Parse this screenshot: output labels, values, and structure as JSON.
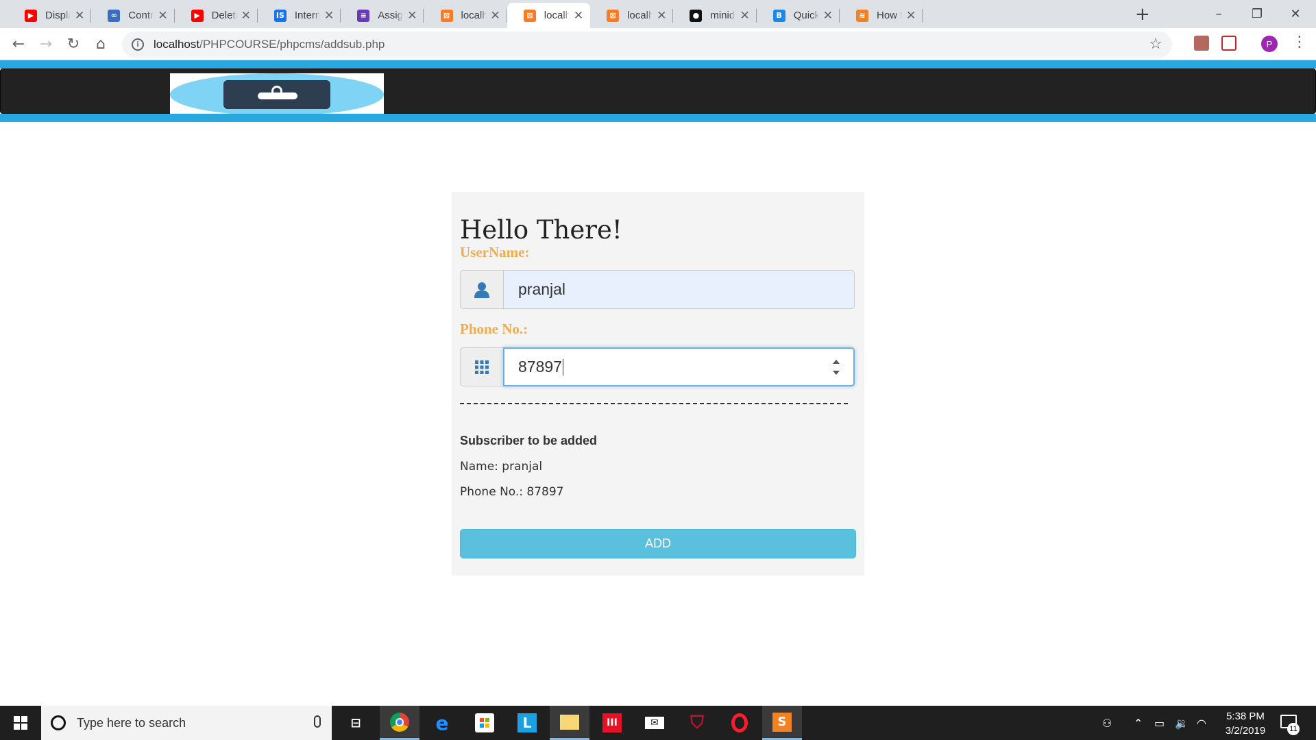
{
  "browser": {
    "tabs": [
      {
        "title": "Displaying",
        "favicon": "youtube-icon",
        "color": "#ff0000",
        "glyph": "▶"
      },
      {
        "title": "Control St",
        "favicon": "infinity-icon",
        "color": "#3b6ec2",
        "glyph": "∞"
      },
      {
        "title": "Deleting a",
        "favicon": "youtube-icon",
        "color": "#ff0000",
        "glyph": "▶"
      },
      {
        "title": "Internship",
        "favicon": "internshala-icon",
        "color": "#1a73e8",
        "glyph": "IS"
      },
      {
        "title": "Assignmen",
        "favicon": "forms-icon",
        "color": "#673ab7",
        "glyph": "≡"
      },
      {
        "title": "localhost/",
        "favicon": "xampp-icon",
        "color": "#fb7a24",
        "glyph": "⊠"
      },
      {
        "title": "localhost/",
        "favicon": "xampp-icon",
        "color": "#fb7a24",
        "glyph": "⊠",
        "active": true
      },
      {
        "title": "localhost/",
        "favicon": "xampp-icon",
        "color": "#fb7a24",
        "glyph": "⊠"
      },
      {
        "title": "minidirect",
        "favicon": "github-icon",
        "color": "#111111",
        "glyph": "●"
      },
      {
        "title": "Quick Star",
        "favicon": "bootstrap-icon",
        "color": "#1e88e5",
        "glyph": "B"
      },
      {
        "title": "How to up",
        "favicon": "stackoverflow-icon",
        "color": "#f48024",
        "glyph": "≋"
      }
    ],
    "url_host": "localhost",
    "url_path": "/PHPCOURSE/phpcms/addsub.php",
    "profile_initial": "P"
  },
  "form": {
    "heading": "Hello There!",
    "username_label": "UserName:",
    "username_value": "pranjal",
    "phone_label": "Phone No.:",
    "phone_value": "87897",
    "divider": "---------------------------------------------------------------------------------------------------------",
    "summary_title": "Subscriber to be added",
    "summary_name": "Name: pranjal",
    "summary_phone": "Phone No.: 87897",
    "add_button": "ADD"
  },
  "colors": {
    "accent_blue": "#29a7df",
    "navbar": "#222222",
    "label_orange": "#f0ad4e",
    "button_info": "#5bc0de"
  },
  "taskbar": {
    "search_placeholder": "Type here to search",
    "time": "5:38 PM",
    "date": "3/2/2019",
    "notification_count": "11"
  }
}
